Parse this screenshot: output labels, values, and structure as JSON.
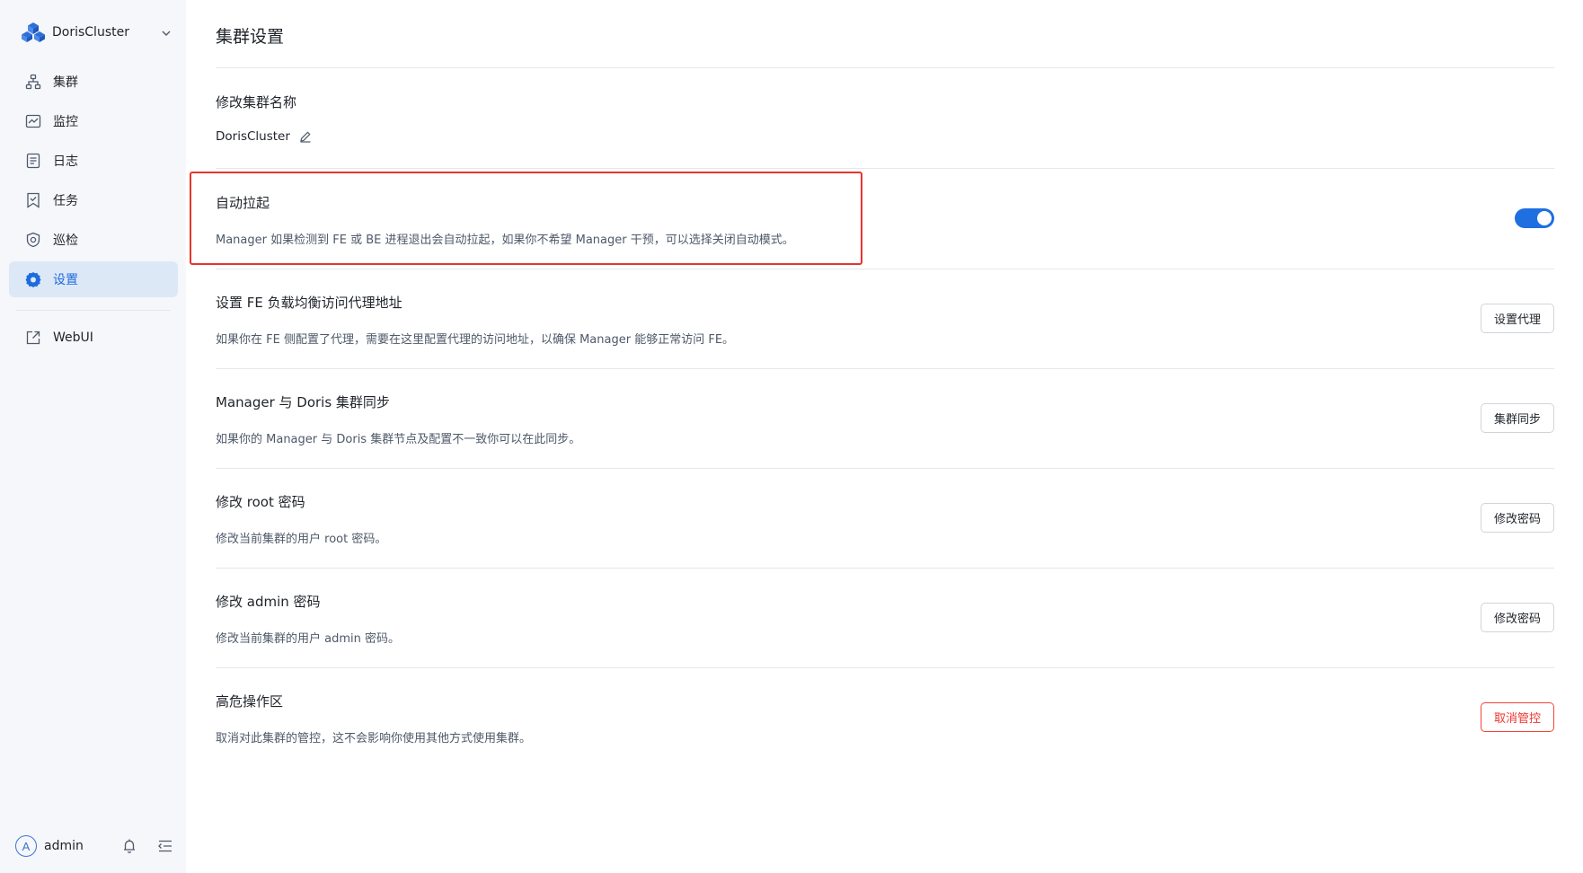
{
  "sidebar": {
    "cluster_name": "DorisCluster",
    "nav": [
      {
        "label": "集群",
        "icon": "cluster-icon"
      },
      {
        "label": "监控",
        "icon": "monitor-icon"
      },
      {
        "label": "日志",
        "icon": "log-icon"
      },
      {
        "label": "任务",
        "icon": "task-icon"
      },
      {
        "label": "巡检",
        "icon": "inspection-icon"
      },
      {
        "label": "设置",
        "icon": "settings-icon",
        "active": true
      }
    ],
    "webui_label": "WebUI",
    "user": {
      "avatar_letter": "A",
      "name": "admin"
    }
  },
  "page": {
    "title": "集群设置",
    "sections": {
      "rename": {
        "title": "修改集群名称",
        "value": "DorisCluster"
      },
      "auto_restart": {
        "title": "自动拉起",
        "desc": "Manager 如果检测到 FE 或 BE 进程退出会自动拉起，如果你不希望 Manager 干预，可以选择关闭自动模式。",
        "enabled": true
      },
      "proxy": {
        "title": "设置 FE 负载均衡访问代理地址",
        "desc": "如果你在 FE 侧配置了代理，需要在这里配置代理的访问地址，以确保 Manager 能够正常访问 FE。",
        "button": "设置代理"
      },
      "sync": {
        "title": "Manager 与 Doris 集群同步",
        "desc": "如果你的 Manager 与 Doris 集群节点及配置不一致你可以在此同步。",
        "button": "集群同步"
      },
      "root_pwd": {
        "title": "修改 root 密码",
        "desc": "修改当前集群的用户 root 密码。",
        "button": "修改密码"
      },
      "admin_pwd": {
        "title": "修改 admin 密码",
        "desc": "修改当前集群的用户 admin 密码。",
        "button": "修改密码"
      },
      "danger": {
        "title": "高危操作区",
        "desc": "取消对此集群的管控，这不会影响你使用其他方式使用集群。",
        "button": "取消管控"
      }
    }
  },
  "colors": {
    "accent": "#1f6fe0",
    "active_nav_bg": "#dde8f7",
    "danger": "#f0352e",
    "highlight": "#e8332d"
  }
}
